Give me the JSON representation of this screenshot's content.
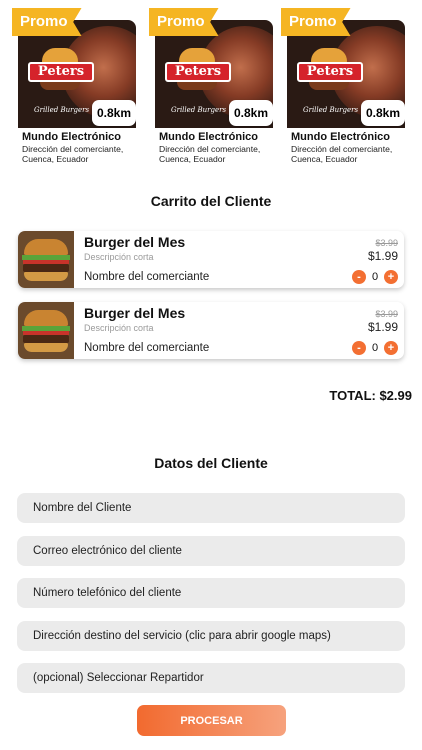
{
  "merchants": [
    {
      "promo": "Promo",
      "logo_text": "Peters",
      "logo_sub": "Grilled Burgers",
      "distance": "0.8km",
      "name": "Mundo Electrónico",
      "address": "Dirección del comerciante, Cuenca, Ecuador"
    },
    {
      "promo": "Promo",
      "logo_text": "Peters",
      "logo_sub": "Grilled Burgers",
      "distance": "0.8km",
      "name": "Mundo Electrónico",
      "address": "Dirección del comerciante, Cuenca, Ecuador"
    },
    {
      "promo": "Promo",
      "logo_text": "Peters",
      "logo_sub": "Grilled Burgers",
      "distance": "0.8km",
      "name": "Mundo Electrónico",
      "address": "Dirección del comerciante, Cuenca, Ecuador"
    }
  ],
  "cart": {
    "title": "Carrito del Cliente",
    "items": [
      {
        "title": "Burger del Mes",
        "description": "Descripción corta",
        "merchant": "Nombre del comerciante",
        "old_price": "$3.99",
        "price": "$1.99",
        "minus": "-",
        "quantity": "0",
        "plus": "+"
      },
      {
        "title": "Burger del Mes",
        "description": "Descripción corta",
        "merchant": "Nombre del comerciante",
        "old_price": "$3.99",
        "price": "$1.99",
        "minus": "-",
        "quantity": "0",
        "plus": "+"
      }
    ],
    "total": "TOTAL: $2.99"
  },
  "client": {
    "title": "Datos del Cliente",
    "fields": [
      "Nombre del Cliente",
      "Correo electrónico del cliente",
      "Número telefónico del cliente",
      "Dirección destino del servicio (clic para abrir google maps)",
      "(opcional) Seleccionar Repartidor"
    ],
    "submit": "PROCESAR"
  },
  "colors": {
    "accent": "#f36f32",
    "promo": "#f5b523",
    "field_bg": "#ebebeb",
    "logo_red": "#d5232b"
  }
}
